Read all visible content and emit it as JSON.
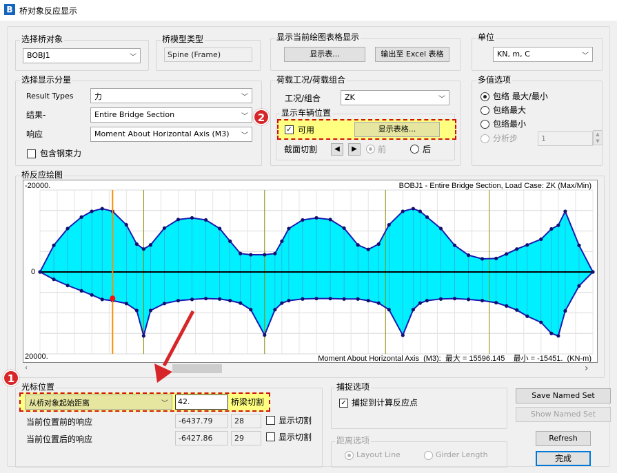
{
  "window": {
    "icon_letter": "B",
    "title": "桥对象反应显示"
  },
  "bridge_object": {
    "label": "选择桥对象",
    "value": "BOBJ1"
  },
  "model_type": {
    "label": "桥模型类型",
    "value": "Spine (Frame)"
  },
  "table_display": {
    "label": "显示当前绘图表格显示",
    "show_table": "显示表...",
    "export_excel": "输出至 Excel 表格"
  },
  "units": {
    "label": "单位",
    "value": "KN, m, C"
  },
  "components": {
    "label": "选择显示分量",
    "result_type_label": "Result Types",
    "result_type_value": "力",
    "result_label": "结果-",
    "result_value": "Entire Bridge Section",
    "response_label": "响应",
    "response_value": "Moment About Horizontal Axis  (M3)",
    "tendon_label": "包含钢束力"
  },
  "load_case": {
    "label": "荷载工况/荷载组合",
    "case_label": "工况/组合",
    "case_value": "ZK"
  },
  "vehicle": {
    "label": "显示车辆位置",
    "enabled_label": "可用",
    "show_table": "显示表格...",
    "cut_label": "截面切割",
    "front": "前",
    "back": "后"
  },
  "multivalue": {
    "label": "多值选项",
    "opt1": "包络 最大/最小",
    "opt2": "包络最大",
    "opt3": "包络最小",
    "opt4": "分析步",
    "step_value": "1",
    "selected": "opt1"
  },
  "plot_group": {
    "label": "桥反应绘图"
  },
  "cursor": {
    "label": "光标位置",
    "mode_value": "从桥对象起始距离",
    "distance_value": "42.",
    "cut_label": "桥梁切割",
    "before_label": "当前位置前的响应",
    "before_value": "-6437.79",
    "before_index": "28",
    "after_label": "当前位置后的响应",
    "after_value": "-6427.86",
    "after_index": "29",
    "show_cut": "显示切割"
  },
  "snap": {
    "label": "捕捉选项",
    "snap_label": "捕捉到计算反应点"
  },
  "distance_opts": {
    "label": "距离选项",
    "layout": "Layout Line",
    "girder": "Girder Length"
  },
  "buttons": {
    "save_named": "Save Named Set",
    "show_named": "Show Named Set",
    "refresh": "Refresh",
    "done": "完成"
  },
  "markers": {
    "one": "1",
    "two": "2"
  },
  "colors": {
    "fill": "#00f0ff",
    "line": "#1a1ab0",
    "cursor": "#ff8c00",
    "accent": "#1565c0",
    "highlight": "#ffff80",
    "marker": "#d7262a"
  },
  "chart_data": {
    "type": "area",
    "title": "BOBJ1 - Entire Bridge Section,  Load Case: ZK (Max/Min)",
    "ytop_label": "-20000.",
    "ybottom_label": "20000.",
    "zero_label": "0",
    "footer": "Moment About Horizontal Axis  (M3):  最大 = 15596.145    最小 = -15451.  (KN-m)",
    "ylim": [
      -20000,
      20000
    ],
    "x": [
      0,
      8,
      16,
      24,
      30,
      36,
      42,
      50,
      56,
      60,
      64,
      72,
      80,
      88,
      96,
      104,
      110,
      116,
      122,
      130,
      136,
      140,
      144,
      152,
      160,
      168,
      176,
      184,
      190,
      196,
      202,
      210,
      216,
      220,
      224,
      232,
      240,
      248,
      256,
      264,
      270,
      276,
      282,
      290,
      296,
      300,
      304,
      312,
      320
    ],
    "min_values": [
      0,
      1800,
      3300,
      4600,
      5600,
      6700,
      7000,
      7700,
      9400,
      15596,
      9400,
      7700,
      7000,
      6700,
      6500,
      6600,
      7000,
      7600,
      9200,
      15400,
      9200,
      7600,
      7000,
      6600,
      6500,
      6500,
      6600,
      6600,
      7000,
      7600,
      9200,
      15451,
      9200,
      7600,
      7000,
      6600,
      6500,
      6700,
      7000,
      7500,
      8300,
      9300,
      10800,
      12300,
      15000,
      15596,
      9500,
      3400,
      0
    ],
    "max_values": [
      0,
      -6500,
      -10600,
      -13400,
      -14800,
      -15451,
      -14800,
      -11500,
      -6800,
      -5600,
      -6600,
      -10700,
      -12800,
      -13200,
      -12700,
      -10600,
      -7500,
      -4500,
      -4200,
      -4200,
      -4500,
      -7500,
      -10600,
      -12700,
      -13200,
      -12800,
      -10700,
      -6600,
      -5500,
      -6800,
      -11500,
      -14800,
      -15451,
      -14800,
      -13400,
      -10600,
      -6500,
      -4100,
      -3200,
      -3300,
      -4400,
      -5600,
      -6600,
      -8000,
      -10500,
      -11400,
      -14800,
      -6500,
      0
    ],
    "cursor_x": 42,
    "cursor_y": 6437.79,
    "supports_x": [
      60,
      130,
      200,
      260
    ]
  }
}
